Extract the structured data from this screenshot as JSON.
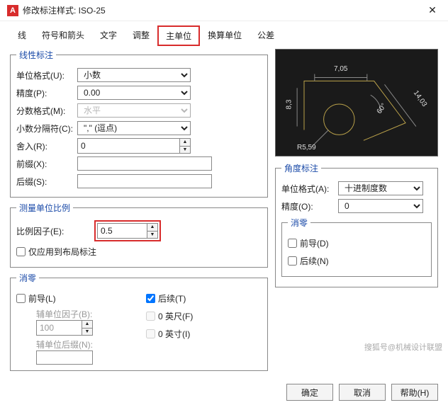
{
  "title": "修改标注样式: ISO-25",
  "tabs": {
    "t0": "线",
    "t1": "符号和箭头",
    "t2": "文字",
    "t3": "调整",
    "t4": "主单位",
    "t5": "换算单位",
    "t6": "公差"
  },
  "linear": {
    "legend": "线性标注",
    "unitFormat": {
      "label": "单位格式(U):",
      "value": "小数"
    },
    "precision": {
      "label": "精度(P):",
      "value": "0.00"
    },
    "fracFormat": {
      "label": "分数格式(M):",
      "value": "水平"
    },
    "decSep": {
      "label": "小数分隔符(C):",
      "value": "\",\" (逗点)"
    },
    "round": {
      "label": "舍入(R):",
      "value": "0"
    },
    "prefix": {
      "label": "前缀(X):",
      "value": ""
    },
    "suffix": {
      "label": "后缀(S):",
      "value": ""
    }
  },
  "scale": {
    "legend": "测量单位比例",
    "factor": {
      "label": "比例因子(E):",
      "value": "0.5"
    },
    "layoutOnly": "仅应用到布局标注"
  },
  "zeroL": {
    "legend": "消零",
    "lead": "前导(L)",
    "trail": "后续(T)",
    "subFactor": {
      "label": "辅单位因子(B):",
      "value": "100"
    },
    "subSuffix": {
      "label": "辅单位后缀(N):",
      "value": ""
    },
    "feet": "0 英尺(F)",
    "inch": "0 英寸(I)"
  },
  "angle": {
    "legend": "角度标注",
    "unitFormat": {
      "label": "单位格式(A):",
      "value": "十进制度数"
    },
    "precision": {
      "label": "精度(O):",
      "value": "0"
    },
    "zero": {
      "legend": "消零",
      "lead": "前导(D)",
      "trail": "后续(N)"
    }
  },
  "preview": {
    "d1": "7,05",
    "d2": "8,3",
    "d3": "R5,59",
    "d4": "60°",
    "d5": "14,03"
  },
  "footer": {
    "ok": "确定",
    "cancel": "取消",
    "help": "帮助(H)"
  },
  "watermark": "搜狐号@机械设计联盟"
}
